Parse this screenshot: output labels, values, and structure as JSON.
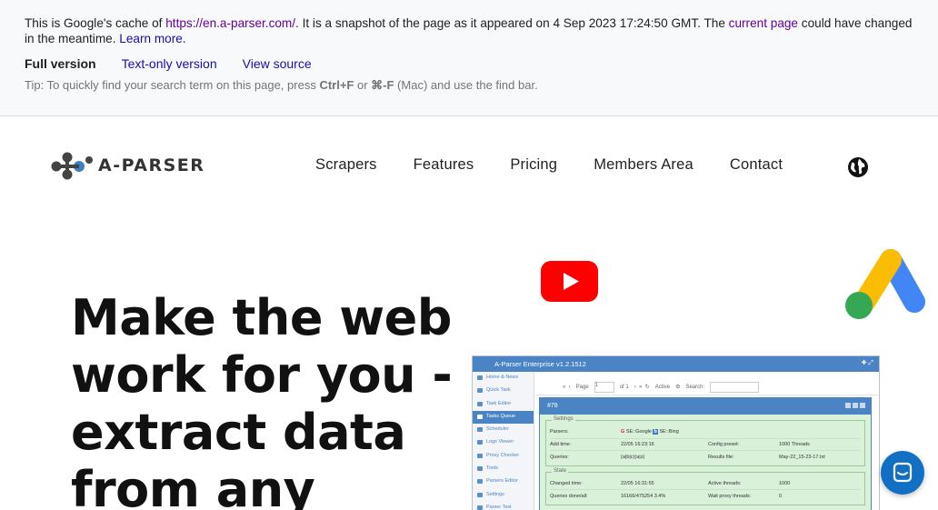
{
  "cache_banner": {
    "text_before_url": "This is Google's cache of ",
    "url": "https://en.a-parser.com/",
    "text_after_url": ". It is a snapshot of the page as it appeared on 4 Sep 2023 17:24:50 GMT. The ",
    "current_page_link": "current page",
    "text_after_link": " could have changed in the meantime. ",
    "learn_more": "Learn more.",
    "full_version": "Full version",
    "text_only_version": "Text-only version",
    "view_source": "View source",
    "tip_prefix": "Tip: To quickly find your search term on this page, press ",
    "tip_key1": "Ctrl+F",
    "tip_or": " or ",
    "tip_key2": "⌘-F",
    "tip_suffix": " (Mac) and use the find bar."
  },
  "header": {
    "logo_text": "A-PARSER",
    "nav": [
      "Scrapers",
      "Features",
      "Pricing",
      "Members Area",
      "Contact"
    ],
    "globe_icon": "globe-icon"
  },
  "hero": {
    "headline_lines": [
      "Make the web",
      "work for you -",
      "extract data",
      "from any"
    ]
  },
  "app_preview": {
    "title": "A-Parser Enterprise v1.2.1512",
    "sidebar": [
      "Home & News",
      "Quick Task",
      "Task Editor",
      "Tasks Queue",
      "Scheduler",
      "Logs Viewer",
      "Proxy Checker",
      "Tools",
      "Parsers Editor",
      "Settings",
      "Parser Test"
    ],
    "active_index": 3,
    "toolbar": {
      "page": "Page",
      "page_value": "1",
      "of": "of 1",
      "filter": "Active",
      "search": "Search:"
    },
    "task_id": "#78",
    "settings_legend": "Settings",
    "state_legend": "State",
    "settings_rows": [
      {
        "k1": "Parsers:",
        "v1_google": "SE::Google",
        "v1_bing": "SE::Bing",
        "k2": "",
        "v2": ""
      },
      {
        "k1": "Add time:",
        "v1": "22/05 16:23:16",
        "k2": "Config preset:",
        "v2": "1000 Threads"
      },
      {
        "k1": "Queries:",
        "v1": "(a|b|c)(a|z)",
        "k2": "Results file:",
        "v2": "May-22_15-23-17.txt"
      }
    ],
    "state_rows": [
      {
        "k1": "Changed time:",
        "v1": "22/05 16:31:55",
        "k2": "Active threads:",
        "v2": "1000"
      },
      {
        "k1": "Queries done/all:",
        "v1": "16166/475254 3.4%",
        "k2": "Wait proxy threads:",
        "v2": "0"
      }
    ]
  },
  "chat": {
    "icon": "chat-icon"
  },
  "colors": {
    "link": "#1a0dab",
    "visited": "#660099",
    "brand_blue": "#4a84c4",
    "youtube_red": "#ff0000",
    "chat_blue": "#1170c4"
  }
}
